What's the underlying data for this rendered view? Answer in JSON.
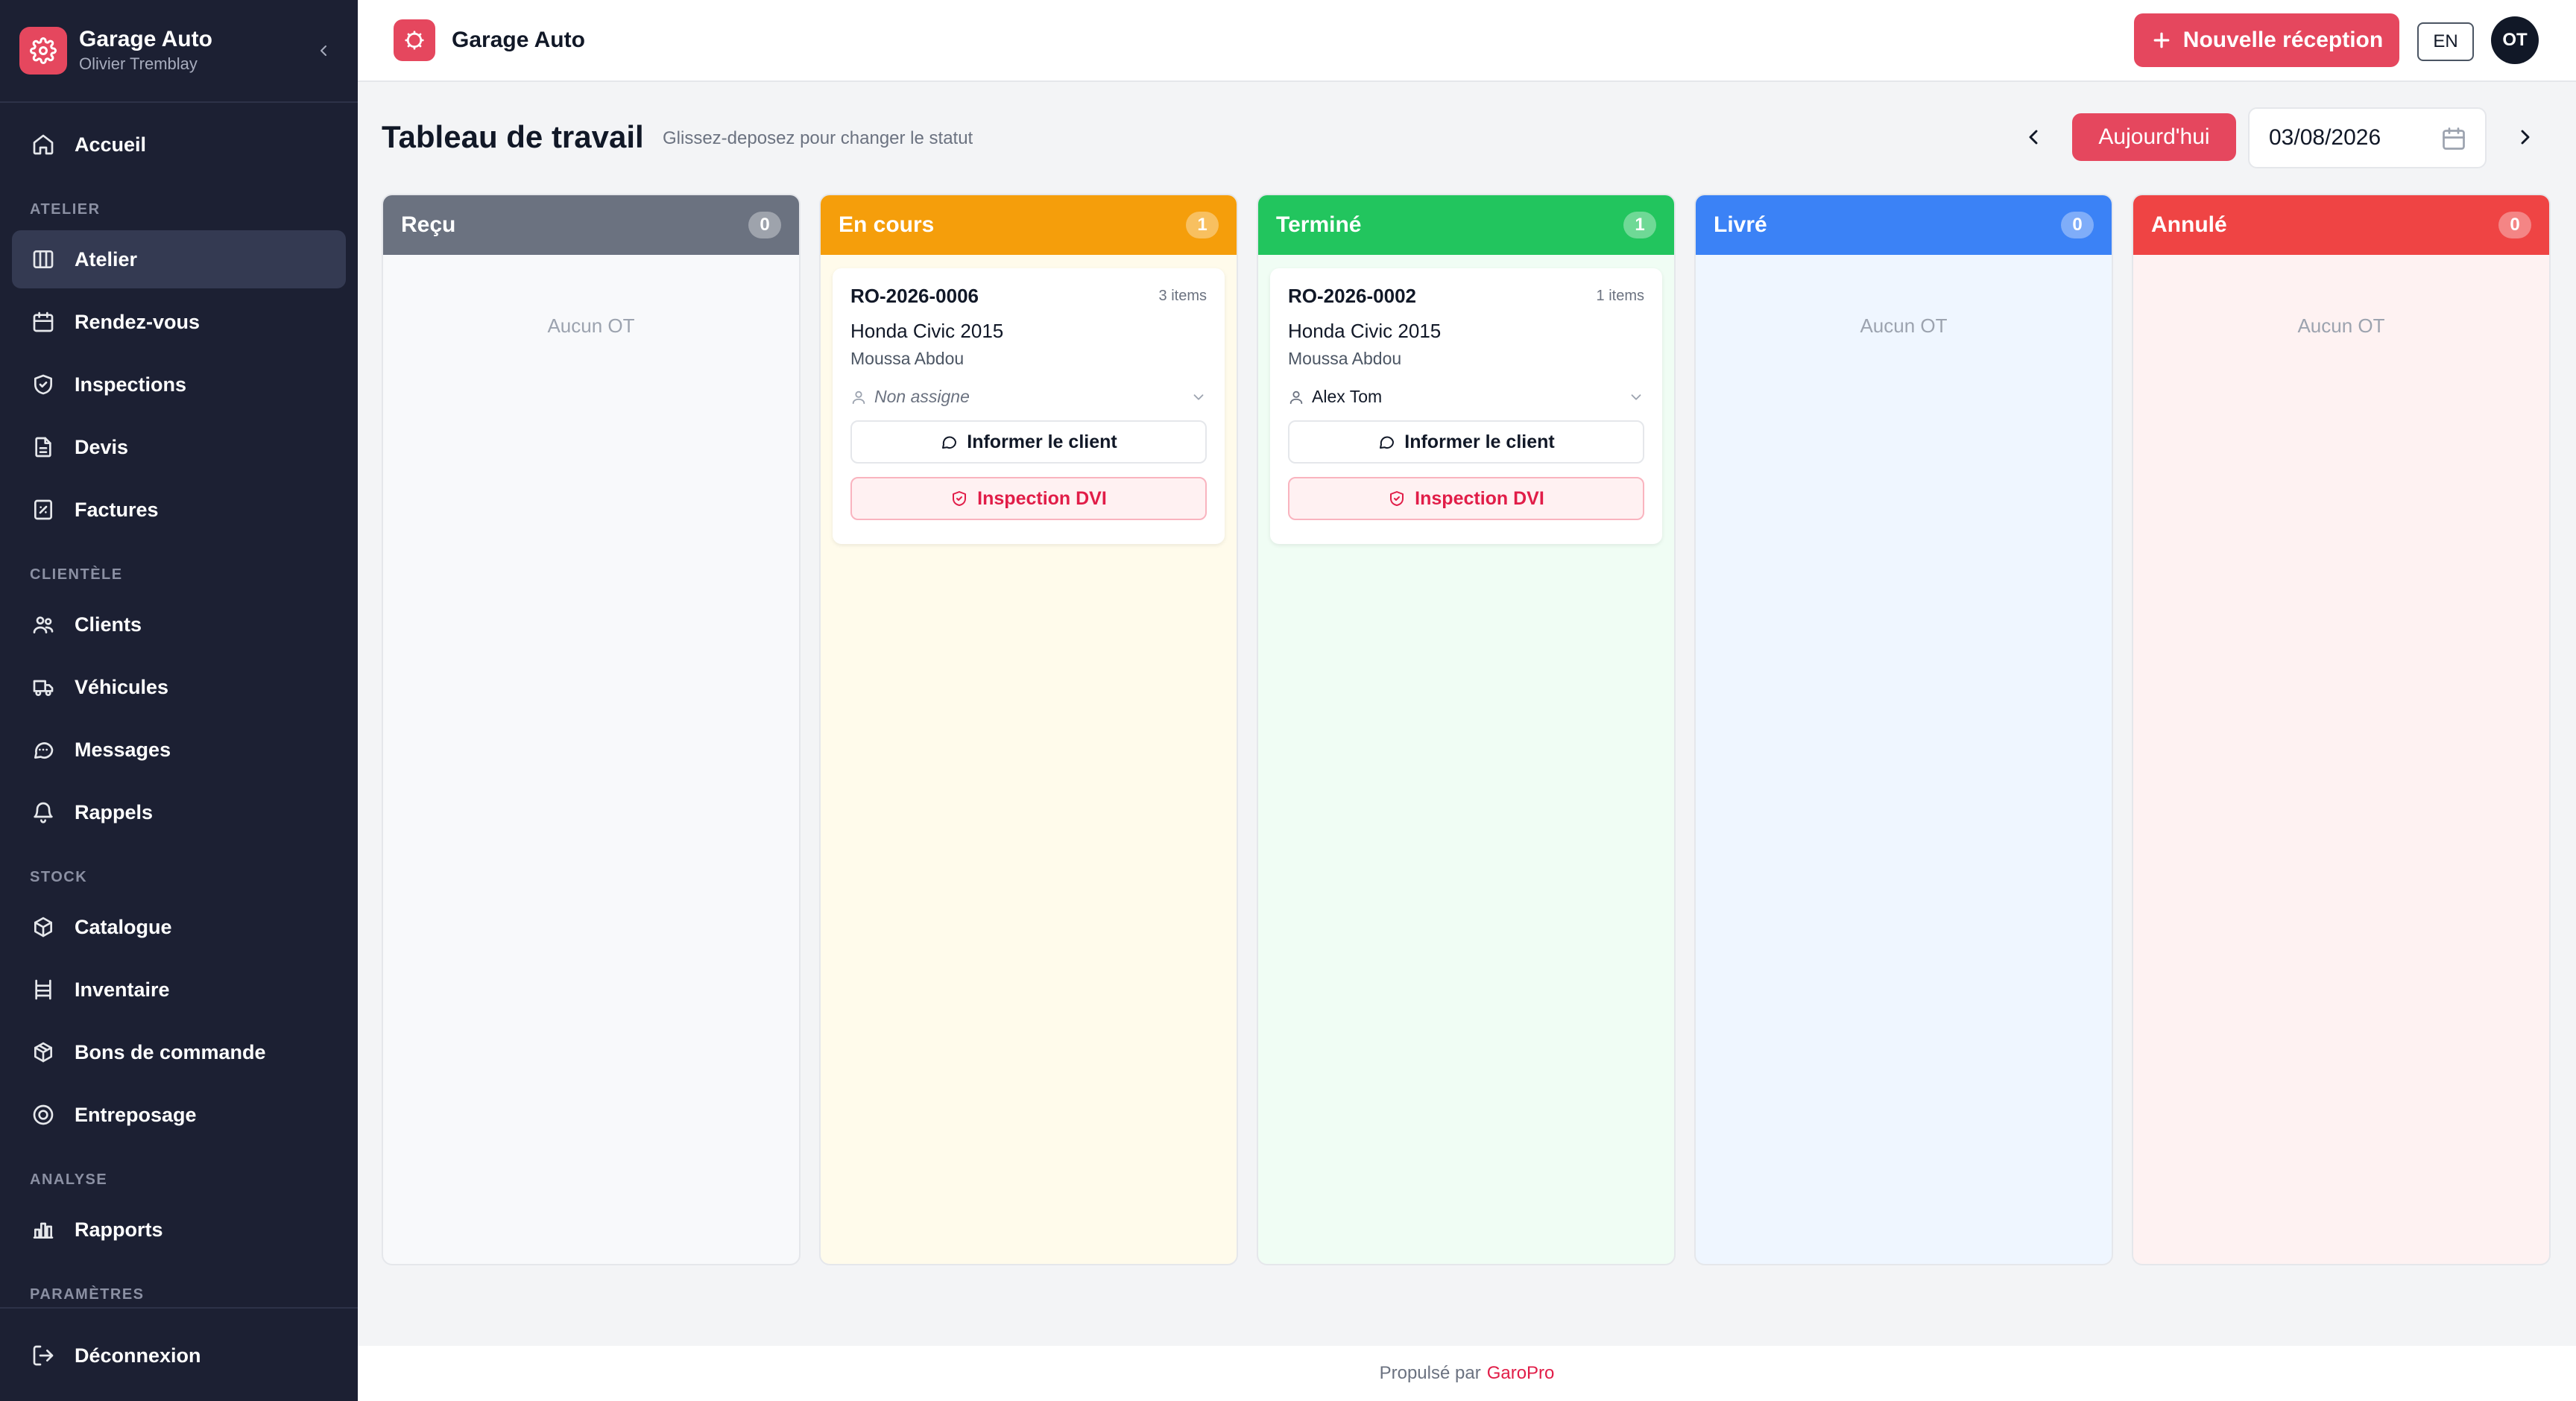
{
  "sidebar": {
    "brand_title": "Garage Auto",
    "brand_user": "Olivier Tremblay",
    "items": {
      "home": "Accueil",
      "workshop": "Atelier",
      "appointments": "Rendez-vous",
      "inspections": "Inspections",
      "quotes": "Devis",
      "invoices": "Factures",
      "clients": "Clients",
      "vehicles": "Véhicules",
      "messages": "Messages",
      "reminders": "Rappels",
      "catalog": "Catalogue",
      "inventory": "Inventaire",
      "purchase_orders": "Bons de commande",
      "storage": "Entreposage",
      "reports": "Rapports",
      "logout": "Déconnexion"
    },
    "sections": {
      "workshop": "ATELIER",
      "clientele": "CLIENTÈLE",
      "stock": "STOCK",
      "analysis": "ANALYSE",
      "settings": "PARAMÈTRES"
    }
  },
  "topbar": {
    "title": "Garage Auto",
    "new_button": "Nouvelle réception",
    "lang": "EN",
    "avatar": "OT"
  },
  "page": {
    "title": "Tableau de travail",
    "subtitle": "Glissez-deposez pour changer le statut",
    "today_button": "Aujourd'hui",
    "date": "03/08/2026"
  },
  "columns": [
    {
      "name": "Reçu",
      "count": "0",
      "empty": "Aucun OT",
      "color": "#6b7280",
      "bg": "#f8f9fb"
    },
    {
      "name": "En cours",
      "count": "1",
      "empty": "",
      "color": "#f59e0b",
      "bg": "#fffbeb"
    },
    {
      "name": "Terminé",
      "count": "1",
      "empty": "",
      "color": "#22c55e",
      "bg": "#f0fdf4"
    },
    {
      "name": "Livré",
      "count": "0",
      "empty": "Aucun OT",
      "color": "#3b82f6",
      "bg": "#eff6ff"
    },
    {
      "name": "Annulé",
      "count": "0",
      "empty": "Aucun OT",
      "color": "#ef4444",
      "bg": "#fef2f2"
    }
  ],
  "cards": [
    {
      "ro": "RO-2026-0006",
      "items": "3 items",
      "vehicle": "Honda Civic 2015",
      "customer": "Moussa Abdou",
      "assignee": "Non assigne",
      "inform": "Informer le client",
      "dvi": "Inspection DVI"
    },
    {
      "ro": "RO-2026-0002",
      "items": "1 items",
      "vehicle": "Honda Civic 2015",
      "customer": "Moussa Abdou",
      "assignee": "Alex Tom",
      "inform": "Informer le client",
      "dvi": "Inspection DVI"
    }
  ],
  "footer": {
    "prefix": "Propulsé par",
    "brand": "GaroPro"
  }
}
